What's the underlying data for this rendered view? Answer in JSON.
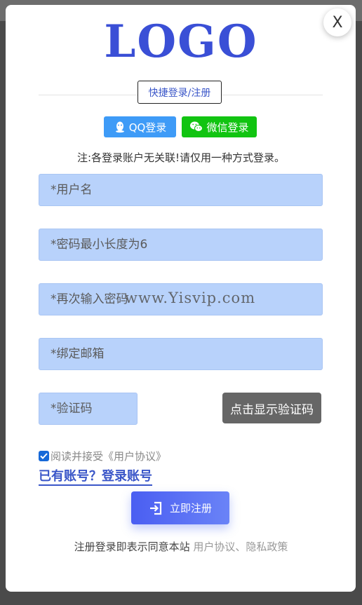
{
  "modal": {
    "close_label": "X",
    "logo_text": "LOGO",
    "quick_tab_label": "快捷登录/注册",
    "social": {
      "qq_label": "QQ登录",
      "wechat_label": "微信登录"
    },
    "notice": "注:各登录账户无关联!请仅用一种方式登录。",
    "fields": {
      "username_placeholder": "*用户名",
      "password_placeholder": "*密码最小长度为6",
      "confirm_password_placeholder": "*再次输入密码",
      "email_placeholder": "*绑定邮箱",
      "captcha_placeholder": "*验证码"
    },
    "captcha_button_label": "点击显示验证码",
    "watermark": "www.Yisvip.com",
    "agree_label": "阅读并接受《用户协议》",
    "have_account_label": "已有账号？登录账号",
    "register_button_label": "立即注册",
    "footer": {
      "prefix": "注册登录即表示同意本站",
      "user_agreement": "用户协议",
      "separator": "、",
      "privacy_policy": "隐私政策"
    }
  },
  "colors": {
    "logo": "#3a4fd6",
    "qq": "#3e9bf7",
    "wechat": "#11c411",
    "field_bg": "#b8d2fb",
    "primary": "#4a5ef2"
  }
}
